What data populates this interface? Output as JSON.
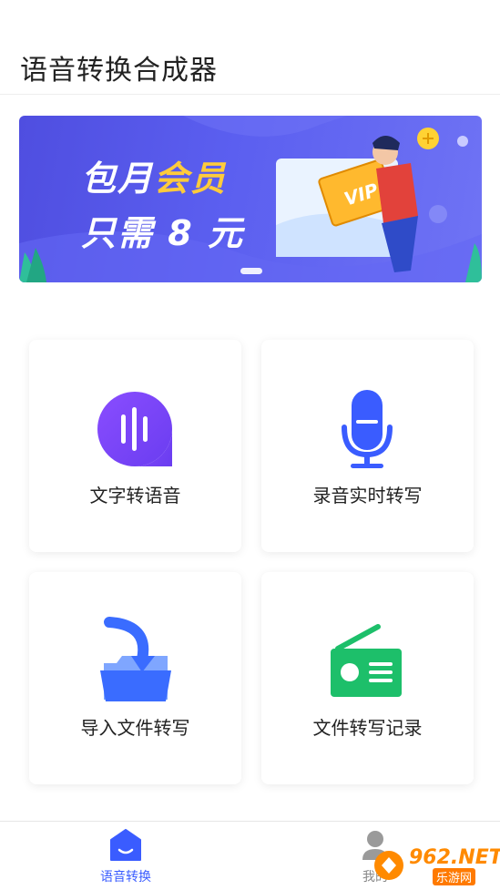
{
  "header": {
    "title": "语音转换合成器"
  },
  "banner": {
    "line1_prefix": "包月",
    "line1_highlight": "会员",
    "line2_prefix": "只需",
    "line2_highlight": "8",
    "line2_suffix": "元",
    "badge_text": "VIP",
    "colors": {
      "background": "#5558ea",
      "highlight": "#ffcb3b"
    }
  },
  "features": [
    {
      "label": "文字转语音",
      "icon": "speech-bubble-icon"
    },
    {
      "label": "录音实时转写",
      "icon": "microphone-icon"
    },
    {
      "label": "导入文件转写",
      "icon": "import-folder-icon"
    },
    {
      "label": "文件转写记录",
      "icon": "radio-icon"
    }
  ],
  "tabbar": {
    "tabs": [
      {
        "label": "语音转换",
        "icon": "home-icon",
        "active": true,
        "color": "#3a5cff"
      },
      {
        "label": "我的",
        "icon": "user-icon",
        "active": false,
        "color": "#888888"
      }
    ]
  },
  "watermark": {
    "text": "962.NET",
    "sub": "乐游网"
  }
}
